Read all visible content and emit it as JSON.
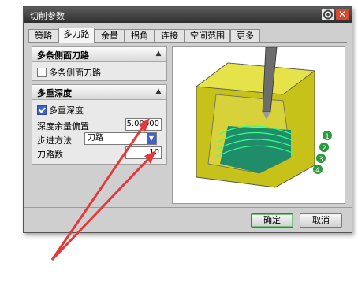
{
  "dialog": {
    "title": "切削参数"
  },
  "tabs": [
    {
      "label": "策略"
    },
    {
      "label": "多刀路"
    },
    {
      "label": "余量"
    },
    {
      "label": "拐角"
    },
    {
      "label": "连接"
    },
    {
      "label": "空间范围"
    },
    {
      "label": "更多"
    }
  ],
  "active_tab": "多刀路",
  "section_side": {
    "title": "多条侧面刀路",
    "checkbox_label": "多条侧面刀路",
    "checked": false
  },
  "section_depth": {
    "title": "多重深度",
    "checkbox_label": "多重深度",
    "checked": true,
    "offset_label": "深度余量偏置",
    "offset_value": "5.00000",
    "step_label": "步进方法",
    "step_value": "刀路",
    "count_label": "刀路数",
    "count_value": "10"
  },
  "preview": {
    "markers": [
      "1",
      "2",
      "3",
      "4"
    ]
  },
  "buttons": {
    "ok": "确定",
    "cancel": "取消"
  },
  "colors": {
    "accent": "#3f63c8",
    "annotation_arrow": "#e23a3a",
    "part": "#c7c21a",
    "toolpath": "#2ee07a"
  }
}
